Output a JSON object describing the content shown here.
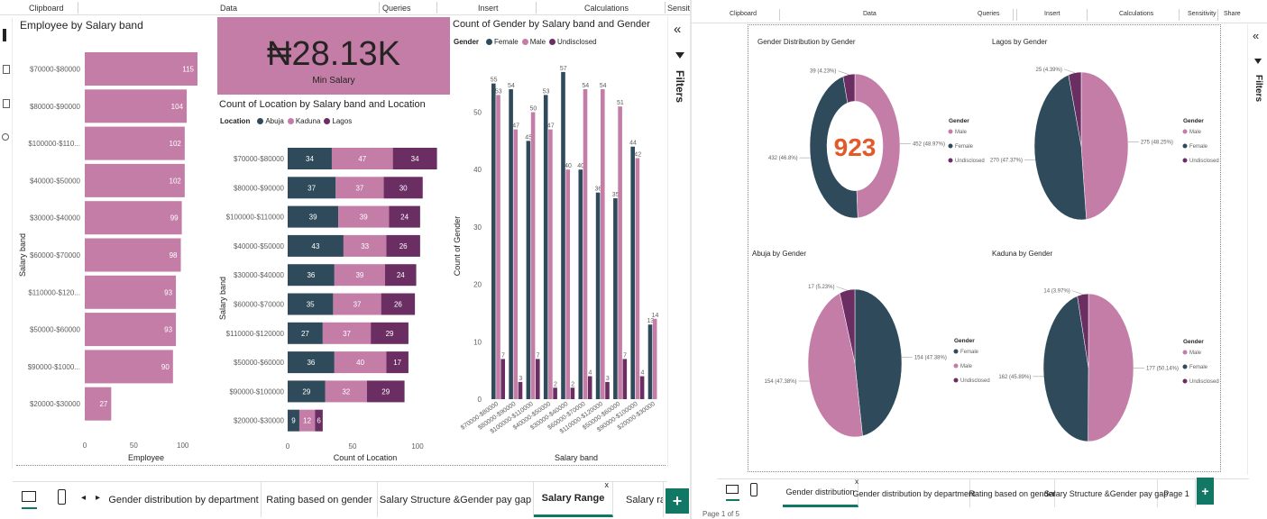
{
  "colors": {
    "female": "#2f4b5b",
    "male": "#c47da6",
    "undisclosed": "#6b2e63",
    "abuja": "#2f4b5b",
    "kaduna": "#c47da6",
    "lagos": "#6b2e63",
    "accent": "#117865",
    "card": "#c47da6",
    "donut_center": "#e15a2a"
  },
  "left": {
    "ribbon": [
      "Clipboard",
      "Data",
      "Queries",
      "Insert",
      "Calculations",
      "Sensitiv"
    ],
    "employee_chart": {
      "title": "Employee by Salary band",
      "ylabel": "Salary band",
      "xlabel": "Employee",
      "x_ticks": [
        "0",
        "50",
        "100"
      ]
    },
    "card": {
      "value": "₦28.13K",
      "label": "Min Salary"
    },
    "location_chart": {
      "title": "Count of Location by Salary band and Location",
      "legend_title": "Location",
      "legend": [
        "Abuja",
        "Kaduna",
        "Lagos"
      ],
      "ylabel": "Salary band",
      "xlabel": "Count of Location",
      "x_ticks": [
        "0",
        "50",
        "100"
      ]
    },
    "gender_chart": {
      "title": "Count of Gender by Salary band and Gender",
      "legend_title": "Gender",
      "legend": [
        "Female",
        "Male",
        "Undisclosed"
      ],
      "ylabel": "Count of Gender",
      "xlabel": "Salary band",
      "y_ticks": [
        "0",
        "10",
        "20",
        "30",
        "40",
        "50"
      ]
    },
    "filters_label": "Filters",
    "filters_collapse": "«",
    "tabs": [
      "Gender distribution by department",
      "Rating based on gender",
      "Salary Structure &Gender pay gap",
      "Salary Range",
      "Salary ran"
    ],
    "active_tab_close": "x",
    "nav_prev": "◂",
    "nav_next": "▸",
    "add_page": "+"
  },
  "right": {
    "ribbon": [
      "Clipboard",
      "Data",
      "Queries",
      "Insert",
      "Calculations",
      "Sensitivity",
      "Share"
    ],
    "donut_center_value": "923",
    "pies": [
      {
        "title": "Gender Distribution by Gender",
        "legend_title": "Gender",
        "legend": [
          "Male",
          "Female",
          "Undisclosed"
        ],
        "labels": [
          "452 (48.97%)",
          "432 (46.8%)",
          "39 (4.23%)"
        ]
      },
      {
        "title": "Lagos by Gender",
        "legend_title": "Gender",
        "legend": [
          "Male",
          "Female",
          "Undisclosed"
        ],
        "labels": [
          "275 (48.25%)",
          "270 (47.37%)",
          "25 (4.39%)"
        ]
      },
      {
        "title": "Abuja by Gender",
        "legend_title": "Gender",
        "legend": [
          "Female",
          "Male",
          "Undisclosed"
        ],
        "labels": [
          "154 (47.38%)",
          "154 (47.38%)",
          "17 (5.23%)"
        ]
      },
      {
        "title": "Kaduna by Gender",
        "legend_title": "Gender",
        "legend": [
          "Male",
          "Female",
          "Undisclosed"
        ],
        "labels": [
          "177 (50.14%)",
          "162 (45.89%)",
          "14 (3.97%)"
        ]
      }
    ],
    "filters_label": "Filters",
    "filters_collapse": "«",
    "tabs": [
      "Gender distribution",
      "Gender distribution by department",
      "Rating based on gender",
      "Salary Structure &Gender pay gap",
      "Page 1"
    ],
    "active_tab_close": "x",
    "add_page": "+",
    "status": "Page 1 of 5"
  },
  "chart_data": [
    {
      "type": "bar",
      "title": "Employee by Salary band",
      "xlabel": "Employee",
      "ylabel": "Salary band",
      "categories": [
        "$70000-$80000",
        "$80000-$90000",
        "$100000-$110...",
        "$40000-$50000",
        "$30000-$40000",
        "$60000-$70000",
        "$110000-$120...",
        "$50000-$60000",
        "$90000-$1000...",
        "$20000-$30000"
      ],
      "values": [
        115,
        104,
        102,
        102,
        99,
        98,
        93,
        93,
        90,
        27
      ],
      "xlim": [
        0,
        130
      ]
    },
    {
      "type": "bar",
      "title": "Count of Location by Salary band and Location",
      "xlabel": "Count of Location",
      "ylabel": "Salary band",
      "categories": [
        "$70000-$80000",
        "$80000-$90000",
        "$100000-$110000",
        "$40000-$50000",
        "$30000-$40000",
        "$60000-$70000",
        "$110000-$120000",
        "$50000-$60000",
        "$90000-$100000",
        "$20000-$30000"
      ],
      "series": [
        {
          "name": "Abuja",
          "values": [
            34,
            37,
            39,
            43,
            36,
            35,
            27,
            36,
            29,
            9
          ]
        },
        {
          "name": "Kaduna",
          "values": [
            47,
            37,
            39,
            33,
            39,
            37,
            37,
            40,
            32,
            12
          ]
        },
        {
          "name": "Lagos",
          "values": [
            34,
            30,
            24,
            26,
            24,
            26,
            29,
            17,
            29,
            6
          ]
        }
      ],
      "xlim": [
        0,
        125
      ]
    },
    {
      "type": "bar",
      "title": "Count of Gender by Salary band and Gender",
      "xlabel": "Salary band",
      "ylabel": "Count of Gender",
      "categories": [
        "$70000-$80000",
        "$80000-$90000",
        "$100000-$110000",
        "$40000-$50000",
        "$30000-$40000",
        "$60000-$70000",
        "$110000-$120000",
        "$50000-$60000",
        "$90000-$100000",
        "$20000-$30000"
      ],
      "series": [
        {
          "name": "Female",
          "values": [
            55,
            54,
            45,
            53,
            57,
            40,
            36,
            35,
            44,
            13
          ]
        },
        {
          "name": "Male",
          "values": [
            53,
            47,
            50,
            47,
            40,
            54,
            54,
            51,
            42,
            14
          ]
        },
        {
          "name": "Undisclosed",
          "values": [
            7,
            3,
            7,
            2,
            2,
            4,
            3,
            7,
            4,
            0
          ]
        }
      ],
      "ylim": [
        0,
        60
      ]
    },
    {
      "type": "pie",
      "title": "Gender Distribution by Gender",
      "categories": [
        "Male",
        "Female",
        "Undisclosed"
      ],
      "values": [
        452,
        432,
        39
      ],
      "donut": true
    },
    {
      "type": "pie",
      "title": "Lagos by Gender",
      "categories": [
        "Male",
        "Female",
        "Undisclosed"
      ],
      "values": [
        275,
        270,
        25
      ]
    },
    {
      "type": "pie",
      "title": "Abuja by Gender",
      "categories": [
        "Female",
        "Male",
        "Undisclosed"
      ],
      "values": [
        154,
        154,
        17
      ]
    },
    {
      "type": "pie",
      "title": "Kaduna by Gender",
      "categories": [
        "Male",
        "Female",
        "Undisclosed"
      ],
      "values": [
        177,
        162,
        14
      ]
    }
  ]
}
